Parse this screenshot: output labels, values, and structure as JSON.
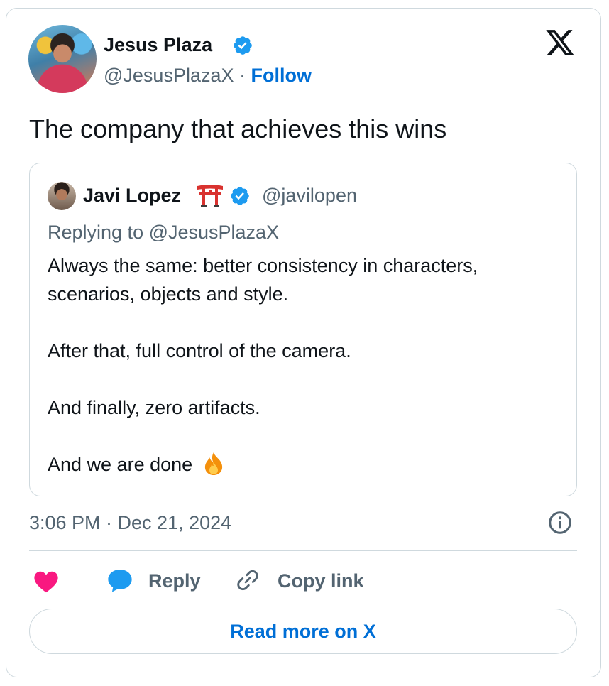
{
  "author": {
    "name": "Jesus Plaza",
    "handle": "@JesusPlazaX",
    "separator": "·",
    "follow_label": "Follow"
  },
  "tweet": {
    "text": "The company that achieves this wins",
    "timestamp": "3:06 PM · Dec 21, 2024"
  },
  "quoted": {
    "name": "Javi Lopez",
    "handle": "@javilopen",
    "replying_to": "Replying to @JesusPlazaX",
    "paragraphs": [
      "Always the same: better consistency in characters, scenarios, objects and style.",
      "After that, full control of the camera.",
      "And finally, zero artifacts.",
      "And we are done"
    ],
    "emoji_icons": [
      "torii-gate-icon",
      "fire-icon"
    ]
  },
  "actions": {
    "reply_label": "Reply",
    "copy_link_label": "Copy link",
    "read_more_label": "Read more on X"
  },
  "colors": {
    "link_blue": "#006fd6",
    "verified_blue": "#1d9bf0",
    "like_pink": "#f91880",
    "muted_text": "#536471",
    "border": "#cfd9de"
  },
  "icons": [
    "x-logo-icon",
    "verified-badge-icon",
    "info-icon",
    "heart-icon",
    "reply-bubble-icon",
    "link-icon"
  ]
}
